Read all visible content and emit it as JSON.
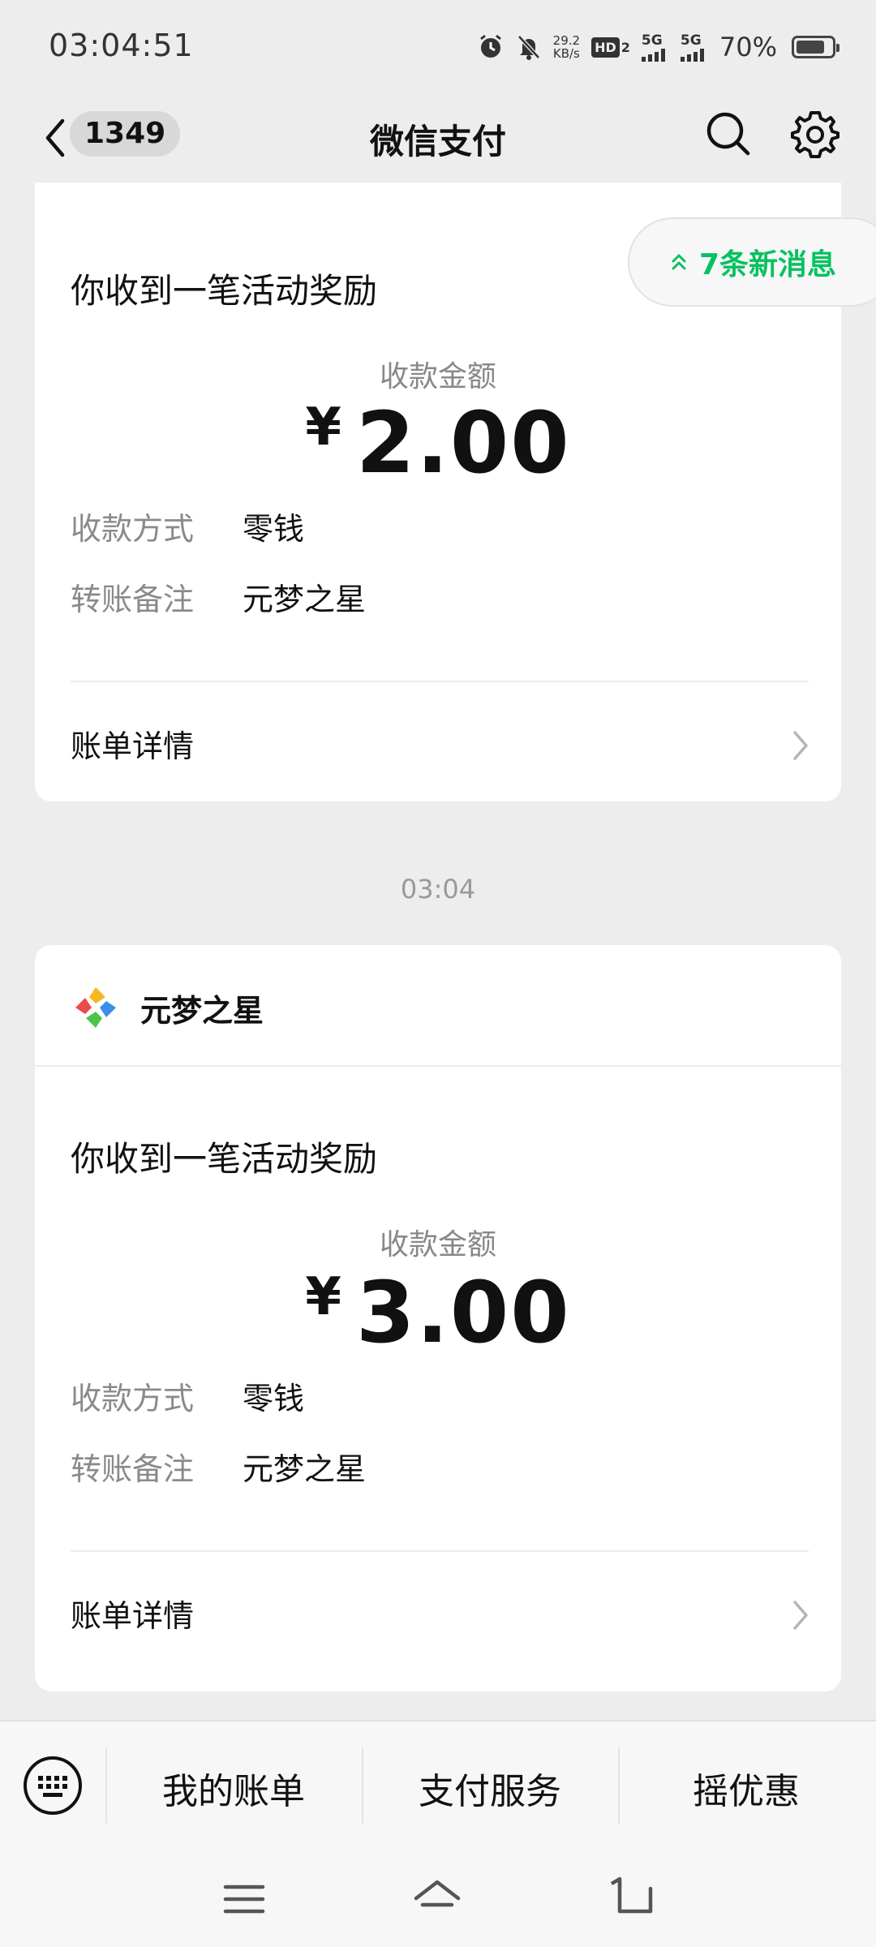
{
  "status_bar": {
    "time": "03:04:51",
    "net_speed_value": "29.2",
    "net_speed_unit": "KB/s",
    "hd_label": "HD",
    "hd_sub": "2",
    "sig1_label": "5G",
    "sig2_label": "5G",
    "battery_percent": "70%",
    "battery_level": 0.7
  },
  "nav": {
    "unread_count": "1349",
    "title": "微信支付"
  },
  "new_messages": {
    "label": "7条新消息"
  },
  "cards": [
    {
      "heading": "你收到一笔活动奖励",
      "amount_label": "收款金额",
      "currency": "¥",
      "amount": "2.00",
      "method_key": "收款方式",
      "method_value": "零钱",
      "note_key": "转账备注",
      "note_value": "元梦之星",
      "bill_link": "账单详情"
    },
    {
      "app_name": "元梦之星",
      "heading": "你收到一笔活动奖励",
      "amount_label": "收款金额",
      "currency": "¥",
      "amount": "3.00",
      "method_key": "收款方式",
      "method_value": "零钱",
      "note_key": "转账备注",
      "note_value": "元梦之星",
      "bill_link": "账单详情"
    }
  ],
  "timestamp": "03:04",
  "bottom_menu": {
    "items": [
      "我的账单",
      "支付服务",
      "摇优惠"
    ]
  },
  "colors": {
    "accent_green": "#07c160",
    "background": "#ededed"
  }
}
